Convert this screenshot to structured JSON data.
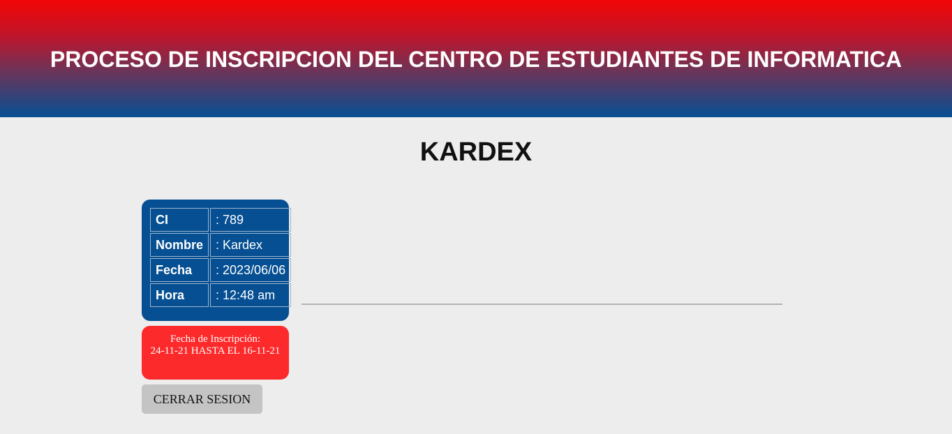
{
  "header": {
    "title": "PROCESO DE INSCRIPCION DEL CENTRO DE ESTUDIANTES DE INFORMATICA"
  },
  "main": {
    "title": "KARDEX"
  },
  "student_info": {
    "rows": [
      {
        "label": "CI",
        "value": ": 789"
      },
      {
        "label": "Nombre",
        "value": ": Kardex"
      },
      {
        "label": "Fecha",
        "value": ": 2023/06/06"
      },
      {
        "label": "Hora",
        "value": ": 12:48 am"
      }
    ]
  },
  "notice": {
    "label": "Fecha de Inscripción:",
    "text": "24-11-21 HASTA EL 16-11-21"
  },
  "actions": {
    "logout_label": "CERRAR SESION"
  },
  "colors": {
    "header_top": "#f20505",
    "header_bottom": "#064f93",
    "card_blue": "#054f92",
    "notice_red": "#fd2a2c",
    "page_bg": "#ededed",
    "button_gray": "#c4c4c4"
  }
}
